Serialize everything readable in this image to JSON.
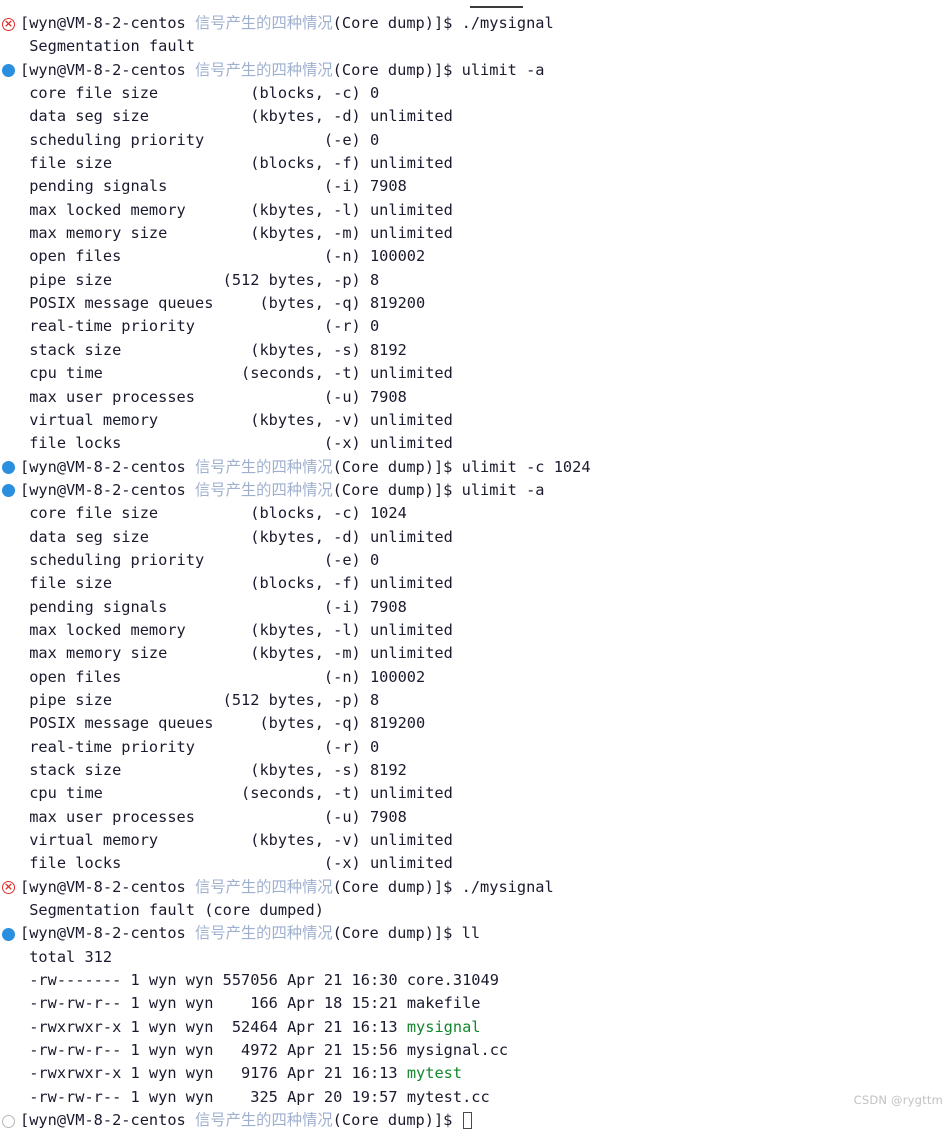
{
  "terminal": {
    "prompt": {
      "user_host": "[wyn@VM-8-2-centos",
      "path_cn": " 信号产生的四种情况",
      "tail": "(Core dump)]$ "
    },
    "markers": {
      "ok": "blue-dot-icon",
      "err": "red-error-circle-icon",
      "idle": "hollow-circle-icon"
    },
    "lines": [
      {
        "type": "prompt",
        "marker": "err",
        "command": "./mysignal"
      },
      {
        "type": "output",
        "text": "Segmentation fault"
      },
      {
        "type": "prompt",
        "marker": "ok",
        "command": "ulimit -a"
      },
      {
        "type": "output",
        "text": "core file size          (blocks, -c) 0"
      },
      {
        "type": "output",
        "text": "data seg size           (kbytes, -d) unlimited"
      },
      {
        "type": "output",
        "text": "scheduling priority             (-e) 0"
      },
      {
        "type": "output",
        "text": "file size               (blocks, -f) unlimited"
      },
      {
        "type": "output",
        "text": "pending signals                 (-i) 7908"
      },
      {
        "type": "output",
        "text": "max locked memory       (kbytes, -l) unlimited"
      },
      {
        "type": "output",
        "text": "max memory size         (kbytes, -m) unlimited"
      },
      {
        "type": "output",
        "text": "open files                      (-n) 100002"
      },
      {
        "type": "output",
        "text": "pipe size            (512 bytes, -p) 8"
      },
      {
        "type": "output",
        "text": "POSIX message queues     (bytes, -q) 819200"
      },
      {
        "type": "output",
        "text": "real-time priority              (-r) 0"
      },
      {
        "type": "output",
        "text": "stack size              (kbytes, -s) 8192"
      },
      {
        "type": "output",
        "text": "cpu time               (seconds, -t) unlimited"
      },
      {
        "type": "output",
        "text": "max user processes              (-u) 7908"
      },
      {
        "type": "output",
        "text": "virtual memory          (kbytes, -v) unlimited"
      },
      {
        "type": "output",
        "text": "file locks                      (-x) unlimited"
      },
      {
        "type": "prompt",
        "marker": "ok",
        "command": "ulimit -c 1024"
      },
      {
        "type": "prompt",
        "marker": "ok",
        "command": "ulimit -a"
      },
      {
        "type": "output",
        "text": "core file size          (blocks, -c) 1024"
      },
      {
        "type": "output",
        "text": "data seg size           (kbytes, -d) unlimited"
      },
      {
        "type": "output",
        "text": "scheduling priority             (-e) 0"
      },
      {
        "type": "output",
        "text": "file size               (blocks, -f) unlimited"
      },
      {
        "type": "output",
        "text": "pending signals                 (-i) 7908"
      },
      {
        "type": "output",
        "text": "max locked memory       (kbytes, -l) unlimited"
      },
      {
        "type": "output",
        "text": "max memory size         (kbytes, -m) unlimited"
      },
      {
        "type": "output",
        "text": "open files                      (-n) 100002"
      },
      {
        "type": "output",
        "text": "pipe size            (512 bytes, -p) 8"
      },
      {
        "type": "output",
        "text": "POSIX message queues     (bytes, -q) 819200"
      },
      {
        "type": "output",
        "text": "real-time priority              (-r) 0"
      },
      {
        "type": "output",
        "text": "stack size              (kbytes, -s) 8192"
      },
      {
        "type": "output",
        "text": "cpu time               (seconds, -t) unlimited"
      },
      {
        "type": "output",
        "text": "max user processes              (-u) 7908"
      },
      {
        "type": "output",
        "text": "virtual memory          (kbytes, -v) unlimited"
      },
      {
        "type": "output",
        "text": "file locks                      (-x) unlimited"
      },
      {
        "type": "prompt",
        "marker": "err",
        "command": "./mysignal"
      },
      {
        "type": "output",
        "text": "Segmentation fault (core dumped)"
      },
      {
        "type": "prompt",
        "marker": "ok",
        "command": "ll"
      },
      {
        "type": "output",
        "text": "total 312"
      },
      {
        "type": "listing",
        "prefix": " -rw------- 1 wyn wyn 557056 Apr 21 16:30 ",
        "name": "core.31049",
        "exec": false
      },
      {
        "type": "listing",
        "prefix": " -rw-rw-r-- 1 wyn wyn    166 Apr 18 15:21 ",
        "name": "makefile",
        "exec": false
      },
      {
        "type": "listing",
        "prefix": " -rwxrwxr-x 1 wyn wyn  52464 Apr 21 16:13 ",
        "name": "mysignal",
        "exec": true
      },
      {
        "type": "listing",
        "prefix": " -rw-rw-r-- 1 wyn wyn   4972 Apr 21 15:56 ",
        "name": "mysignal.cc",
        "exec": false
      },
      {
        "type": "listing",
        "prefix": " -rwxrwxr-x 1 wyn wyn   9176 Apr 21 16:13 ",
        "name": "mytest",
        "exec": true
      },
      {
        "type": "listing",
        "prefix": " -rw-rw-r-- 1 wyn wyn    325 Apr 20 19:57 ",
        "name": "mytest.cc",
        "exec": false
      },
      {
        "type": "prompt",
        "marker": "idle",
        "command": "",
        "cursor": true
      }
    ],
    "colors": {
      "text": "#1a1a2e",
      "cn_path": "#9fb0cf",
      "executable": "#13872b",
      "marker_ok": "#2b8fe0",
      "marker_err": "#e02b2b",
      "marker_idle": "#b6b6b6",
      "background": "#ffffff"
    }
  },
  "watermark": {
    "text": "CSDN @rygttm"
  }
}
